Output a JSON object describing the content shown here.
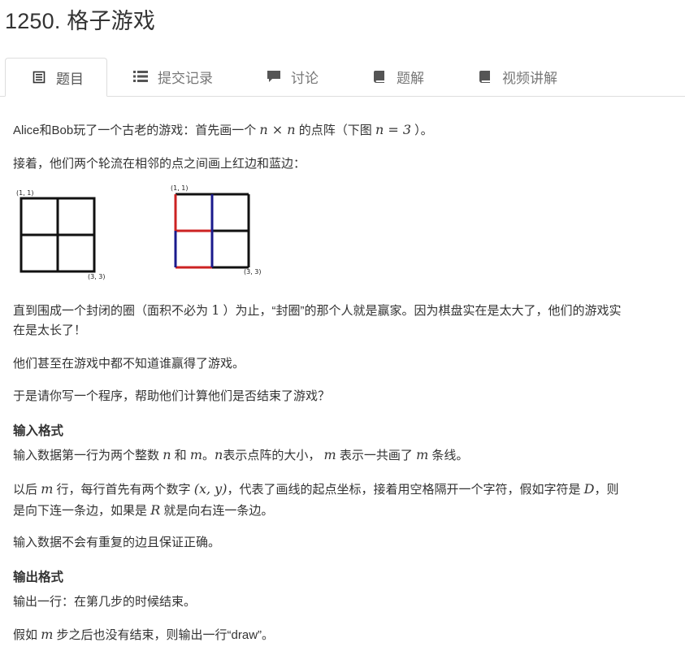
{
  "title": "1250. 格子游戏",
  "tabs": [
    {
      "label": "题目",
      "icon": "document-icon"
    },
    {
      "label": "提交记录",
      "icon": "list-icon"
    },
    {
      "label": "讨论",
      "icon": "comment-icon"
    },
    {
      "label": "题解",
      "icon": "book-icon"
    },
    {
      "label": "视频讲解",
      "icon": "book-icon"
    }
  ],
  "problem": {
    "intro_a": "Alice和Bob玩了一个古老的游戏：首先画一个",
    "intro_math": "n × n",
    "intro_b": "的点阵（下图",
    "intro_math2": "n = 3",
    "intro_c": "）。",
    "line2": "接着，他们两个轮流在相邻的点之间画上红边和蓝边：",
    "fig1_tl": "(1, 1)",
    "fig1_br": "(3, 3)",
    "fig2_tl": "(1, 1)",
    "fig2_br": "(3, 3)",
    "line3a": "直到围成一个封闭的圈（面积不必为",
    "line3_math": "1",
    "line3b": "）为止，“封圈”的那个人就是赢家。因为棋盘实在是太大了，他们的游戏实",
    "line3c": "在是太长了！",
    "line4": "他们甚至在游戏中都不知道谁赢得了游戏。",
    "line5": "于是请你写一个程序，帮助他们计算他们是否结束了游戏？",
    "input_heading": "输入格式",
    "in1_a": "输入数据第一行为两个整数",
    "in1_n": "n",
    "in1_b": "和",
    "in1_m": "m",
    "in1_c": "。",
    "in1_n2": "n",
    "in1_d": "表示点阵的大小，",
    "in1_m2": "m",
    "in1_e": "表示一共画了",
    "in1_m3": "m",
    "in1_f": "条线。",
    "in2_a": "以后",
    "in2_m": "m",
    "in2_b": "行，每行首先有两个数字",
    "in2_xy": "(x, y)",
    "in2_c": "，代表了画线的起点坐标，接着用空格隔开一个字符，假如字符是",
    "in2_D": "D",
    "in2_d": "，则",
    "in2_e": "是向下连一条边，如果是",
    "in2_R": "R",
    "in2_f": "就是向右连一条边。",
    "in3": "输入数据不会有重复的边且保证正确。",
    "output_heading": "输出格式",
    "out1": "输出一行：在第几步的时候结束。",
    "out2_a": "假如",
    "out2_m": "m",
    "out2_b": "步之后也没有结束，则输出一行“draw”。"
  },
  "colors": {
    "red_edge": "#cc2222",
    "blue_edge": "#1a1a8c",
    "tab_border": "#dddddd"
  }
}
